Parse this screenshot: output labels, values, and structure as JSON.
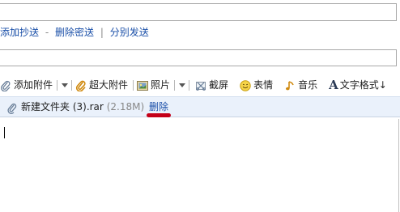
{
  "recipient_links": {
    "add_cc": "添加抄送",
    "dash": "-",
    "remove_bcc": "删除密送",
    "divider": "|",
    "send_separately": "分别发送"
  },
  "toolbar": {
    "add_attachment": "添加附件",
    "large_attachment": "超大附件",
    "photo": "照片",
    "screenshot": "截屏",
    "emoticon": "表情",
    "music": "音乐",
    "text_format": "文字格式↓",
    "text_format_glyph": "A"
  },
  "attachment": {
    "filename": "新建文件夹 (3).rar",
    "size": "(2.18M)",
    "delete_label": "删除"
  },
  "colors": {
    "link": "#1a4fa8",
    "attach_bg": "#eaf1fb",
    "highlight_mark": "#c40018"
  }
}
